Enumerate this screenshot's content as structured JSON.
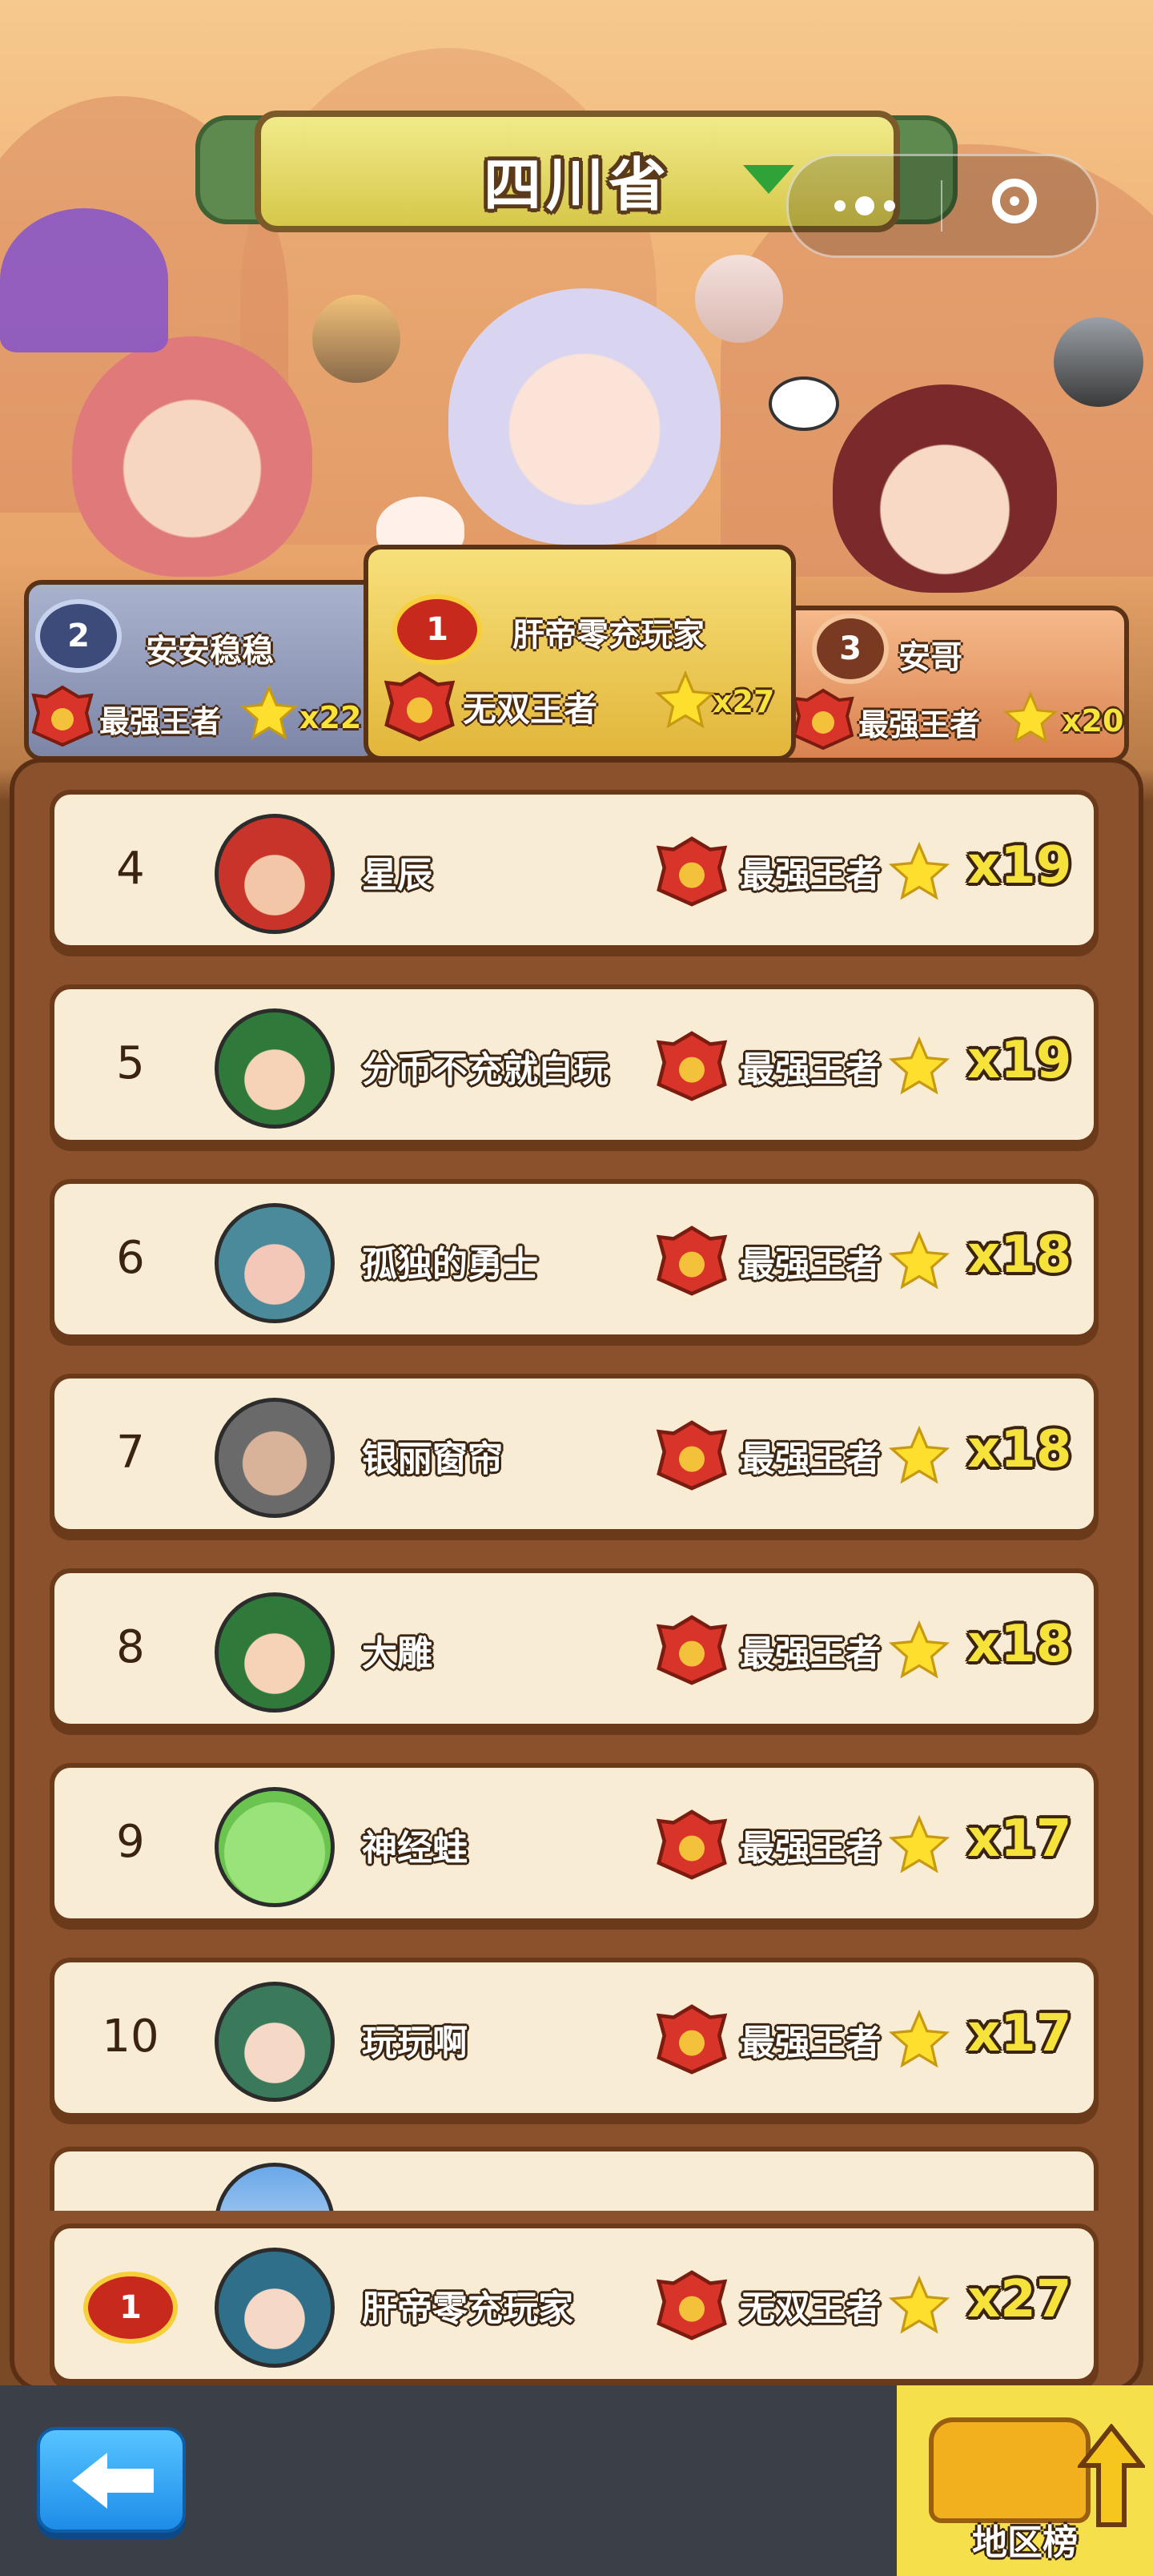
{
  "header": {
    "province": "四川省"
  },
  "podium": [
    {
      "rank": "1",
      "name": "肝帝零充玩家",
      "title": "无双王者",
      "stars": "x27"
    },
    {
      "rank": "2",
      "name": "安安稳稳",
      "title": "最强王者",
      "stars": "x22"
    },
    {
      "rank": "3",
      "name": "安哥",
      "title": "最强王者",
      "stars": "x20"
    }
  ],
  "leaderboard": [
    {
      "rank": "4",
      "name": "星辰",
      "title": "最强王者",
      "stars": "x19"
    },
    {
      "rank": "5",
      "name": "分币不充就白玩",
      "title": "最强王者",
      "stars": "x19"
    },
    {
      "rank": "6",
      "name": "孤独的勇士",
      "title": "最强王者",
      "stars": "x18"
    },
    {
      "rank": "7",
      "name": "银丽窗帘",
      "title": "最强王者",
      "stars": "x18"
    },
    {
      "rank": "8",
      "name": "大雕",
      "title": "最强王者",
      "stars": "x18"
    },
    {
      "rank": "9",
      "name": "神经蛙",
      "title": "最强王者",
      "stars": "x17"
    },
    {
      "rank": "10",
      "name": "玩玩啊",
      "title": "最强王者",
      "stars": "x17"
    }
  ],
  "my_entry": {
    "rank": "1",
    "name": "肝帝零充玩家",
    "title": "无双王者",
    "stars": "x27"
  },
  "bottom_bar": {
    "region_button_label": "地区榜"
  },
  "colors": {
    "accent_yellow": "#f5e23a",
    "board_brown": "#8b512c",
    "row_bg": "#f8ecd4",
    "back_blue": "#1d8ce8"
  }
}
